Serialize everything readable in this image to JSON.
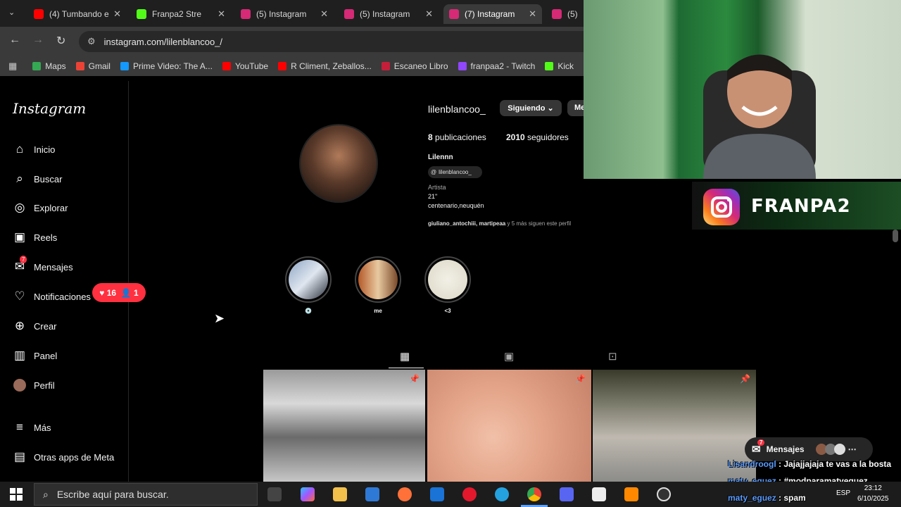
{
  "browser": {
    "tabs": [
      {
        "label": "(4) Tumbando el",
        "color": "#ff0000",
        "active": false
      },
      {
        "label": "Franpa2 Stre",
        "color": "#53fc18",
        "active": false
      },
      {
        "label": "(5) Instagram",
        "color": "#d62976",
        "active": false
      },
      {
        "label": "(5) Instagram",
        "color": "#d62976",
        "active": false
      },
      {
        "label": "(7) Instagram",
        "color": "#d62976",
        "active": true
      },
      {
        "label": "(5) I",
        "color": "#d62976",
        "active": false
      }
    ],
    "url": "instagram.com/lilenblancoo_/",
    "bookmarks": [
      {
        "label": "Maps",
        "color": "#34a853"
      },
      {
        "label": "Gmail",
        "color": "#ea4335"
      },
      {
        "label": "Prime Video: The A...",
        "color": "#1399ff"
      },
      {
        "label": "YouTube",
        "color": "#ff0000"
      },
      {
        "label": "R Climent, Zeballos...",
        "color": "#ff0000"
      },
      {
        "label": "Escaneo Libro",
        "color": "#c41e3a"
      },
      {
        "label": "franpaa2 - Twitch",
        "color": "#9146ff"
      },
      {
        "label": "Kick",
        "color": "#53fc18"
      }
    ]
  },
  "instagram": {
    "logo": "Instagram",
    "nav": {
      "inicio": "Inicio",
      "buscar": "Buscar",
      "explorar": "Explorar",
      "reels": "Reels",
      "mensajes": "Mensajes",
      "mensajes_badge": "7",
      "notificaciones": "Notificaciones",
      "crear": "Crear",
      "panel": "Panel",
      "perfil": "Perfil",
      "mas": "Más",
      "otras_apps": "Otras apps de Meta"
    },
    "notif_pill": {
      "likes": "16",
      "follows": "1"
    },
    "profile": {
      "username": "lilenblancoo_",
      "follow_label": "Siguiendo",
      "message_label": "Me",
      "posts_count": "8",
      "posts_label": "publicaciones",
      "followers_count": "2010",
      "followers_label": "seguidores",
      "full_name": "Lilennn",
      "threads_handle": "lilenblancoo_",
      "category": "Artista",
      "bio_line1": "21\"",
      "bio_line2": "centenario,neuquén",
      "followed_by_users": "giuliano_antochiii, martipeaa",
      "followed_by_rest": " y 5 más siguen este perfil"
    },
    "highlights": [
      {
        "label": "💿"
      },
      {
        "label": "me"
      },
      {
        "label": "<3"
      }
    ]
  },
  "stream": {
    "banner_text": "FRANPA2",
    "messages_popup": "Mensajes",
    "messages_badge": "7",
    "chat": [
      {
        "user": "Lisandroogl",
        "text": " : Jajajjajaja te vas a la bosta"
      },
      {
        "user": "maty_eguez",
        "text": " : #modparamatyeguez"
      },
      {
        "user": "maty_eguez",
        "text": " : spam"
      }
    ]
  },
  "taskbar": {
    "search_placeholder": "Escribe aquí para buscar.",
    "lang": "ESP",
    "time": "23:12",
    "date": "6/10/2025"
  }
}
